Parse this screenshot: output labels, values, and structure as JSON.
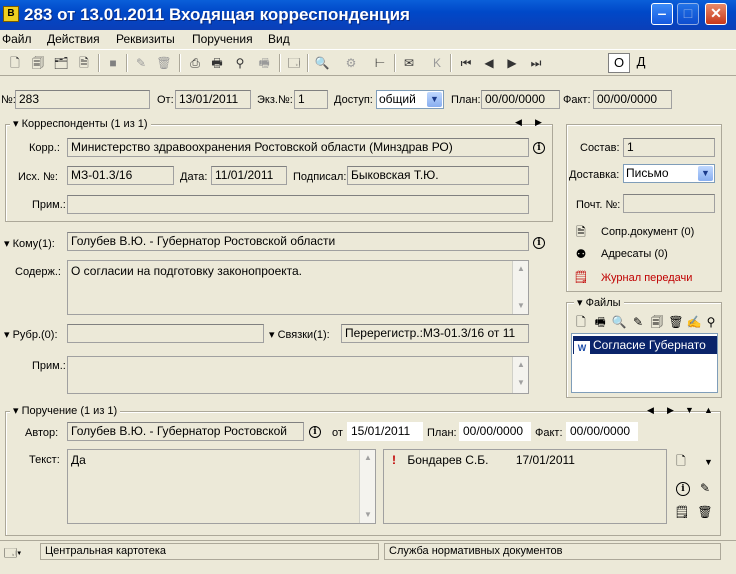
{
  "window": {
    "title": "283 от 13.01.2011 Входящая корреспонденция",
    "icon_label": "B"
  },
  "menu": [
    "Файл",
    "Действия",
    "Реквизиты",
    "Поручения",
    "Вид"
  ],
  "toolbar": {
    "toggle_o": "О",
    "toggle_d": "Д"
  },
  "header": {
    "num_label": "№:",
    "num_value": "283",
    "from_label": "От:",
    "from_value": "13/01/2011",
    "copy_label": "Экз.№:",
    "copy_value": "1",
    "access_label": "Доступ:",
    "access_value": "общий",
    "plan_label": "План:",
    "plan_value": "00/00/0000",
    "fact_label": "Факт:",
    "fact_value": "00/00/0000"
  },
  "correspondents": {
    "title": "Корреспонденты (1 из 1)",
    "corr_label": "Корр.:",
    "corr_value": "Министерство здравоохранения Ростовской области (Минздрав РО)",
    "out_label": "Исх. №:",
    "out_value": "МЗ-01.3/16",
    "date_label": "Дата:",
    "date_value": "11/01/2011",
    "signed_label": "Подписал:",
    "signed_value": "Быковская  Т.Ю.",
    "note_label": "Прим.:",
    "note_value": ""
  },
  "side": {
    "sostav_label": "Состав:",
    "sostav_value": "1",
    "delivery_label": "Доставка:",
    "delivery_value": "Письмо",
    "post_label": "Почт. №:",
    "post_value": "",
    "links": [
      "Сопр.документ (0)",
      "Адресаты (0)",
      "Журнал передачи"
    ]
  },
  "to": {
    "label": "Кому(1):",
    "value": "Голубев В.Ю. - Губернатор Ростовской области"
  },
  "content": {
    "label": "Содерж.:",
    "value": "О согласии на подготовку законопроекта."
  },
  "rubric": {
    "label": "Рубр.(0):",
    "value": ""
  },
  "links_field": {
    "label": "Связки(1):",
    "value": "Перерегистр.:МЗ-01.3/16 от 11"
  },
  "note2": {
    "label": "Прим.:",
    "value": ""
  },
  "files": {
    "title": "Файлы",
    "items": [
      "Согласие Губернато"
    ]
  },
  "assignment": {
    "title": "Поручение (1 из 1)",
    "author_label": "Автор:",
    "author_value": "Голубев В.Ю. - Губернатор Ростовской",
    "from_label": "от",
    "from_value": "15/01/2011",
    "plan_label": "План:",
    "plan_value": "00/00/0000",
    "fact_label": "Факт:",
    "fact_value": "00/00/0000",
    "text_label": "Текст:",
    "text_value": "Да",
    "executors": [
      {
        "mark": "!",
        "name": "Бондарев С.Б.",
        "date": "17/01/2011"
      }
    ]
  },
  "status": {
    "left": "Центральная картотека",
    "right": "Служба нормативных документов"
  },
  "colors": {
    "titlebar": "#0a5fd9",
    "face": "#ece9d8",
    "selection": "#0a246a",
    "alert": "#c00000"
  }
}
